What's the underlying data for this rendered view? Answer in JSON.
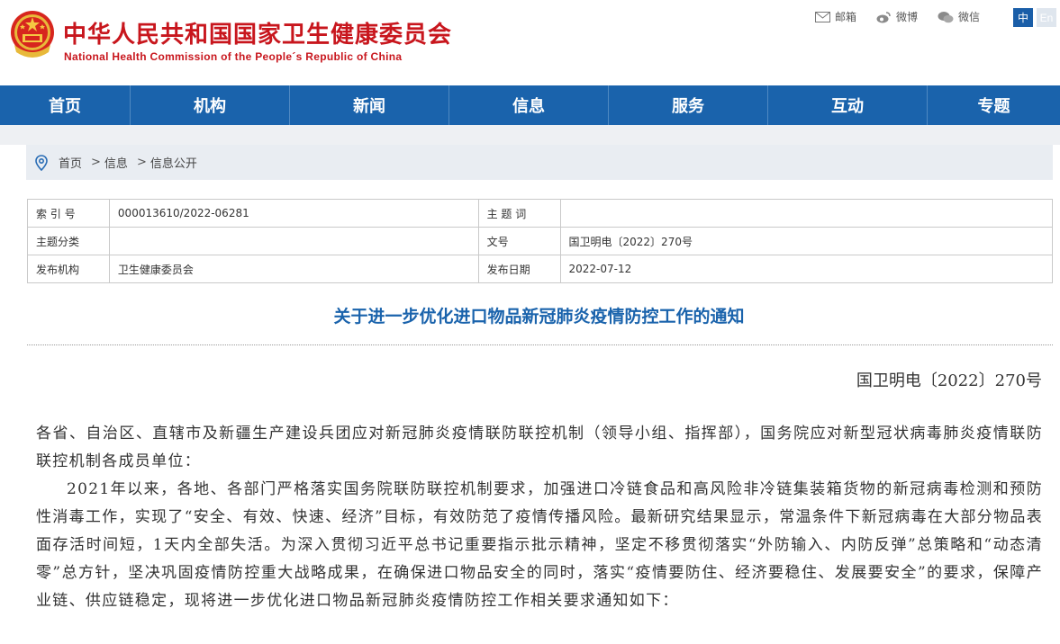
{
  "header": {
    "title_cn": "中华人民共和国国家卫生健康委员会",
    "title_en": "National Health Commission of the People´s Republic of China",
    "links": [
      {
        "icon": "mail-icon",
        "label": "邮箱"
      },
      {
        "icon": "weibo-icon",
        "label": "微博"
      },
      {
        "icon": "wechat-icon",
        "label": "微信"
      }
    ],
    "lang_cn": "中",
    "lang_en": "En"
  },
  "nav": {
    "items": [
      "首页",
      "机构",
      "新闻",
      "信息",
      "服务",
      "互动",
      "专题"
    ]
  },
  "breadcrumb": {
    "items": [
      "首页",
      "信息",
      "信息公开"
    ]
  },
  "info": {
    "rows": [
      {
        "k1": "索 引 号",
        "v1": "000013610/2022-06281",
        "k2": "主 题 词",
        "v2": ""
      },
      {
        "k1": "主题分类",
        "v1": "",
        "k2": "文号",
        "v2": "国卫明电〔2022〕270号"
      },
      {
        "k1": "发布机构",
        "v1": "卫生健康委员会",
        "k2": "发布日期",
        "v2": "2022-07-12"
      }
    ]
  },
  "document": {
    "title": "关于进一步优化进口物品新冠肺炎疫情防控工作的通知",
    "number": "国卫明电〔2022〕270号",
    "addressee": "各省、自治区、直辖市及新疆生产建设兵团应对新冠肺炎疫情联防联控机制（领导小组、指挥部），国务院应对新型冠状病毒肺炎疫情联防联控机制各成员单位：",
    "paragraph1": "2021年以来，各地、各部门严格落实国务院联防联控机制要求，加强进口冷链食品和高风险非冷链集装箱货物的新冠病毒检测和预防性消毒工作，实现了“安全、有效、快速、经济”目标，有效防范了疫情传播风险。最新研究结果显示，常温条件下新冠病毒在大部分物品表面存活时间短，1天内全部失活。为深入贯彻习近平总书记重要指示批示精神，坚定不移贯彻落实“外防输入、内防反弹”总策略和“动态清零”总方针，坚决巩固疫情防控重大战略成果，在确保进口物品安全的同时，落实“疫情要防住、经济要稳住、发展要安全”的要求，保障产业链、供应链稳定，现将进一步优化进口物品新冠肺炎疫情防控工作相关要求通知如下："
  },
  "colors": {
    "brand_red": "#c8161d",
    "nav_blue": "#1a63ac",
    "title_blue": "#1a63ac"
  }
}
